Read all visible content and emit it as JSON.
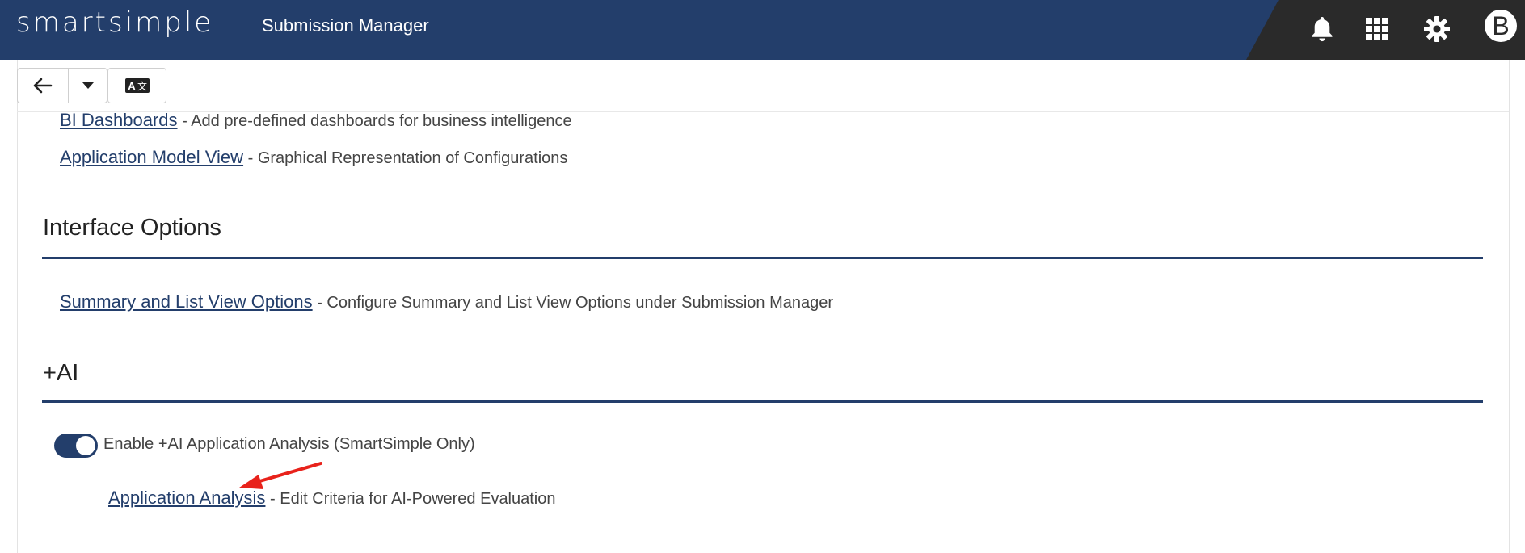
{
  "header": {
    "logo": "smartsimple",
    "app_title": "Submission Manager",
    "avatar_initial": "B",
    "icons": [
      "bell-icon",
      "apps-grid-icon",
      "gear-icon"
    ],
    "bg_color": "#233e6b"
  },
  "toolbar": {
    "buttons": [
      "back-arrow-icon",
      "dropdown-caret-icon",
      "translate-icon"
    ]
  },
  "links_top": [
    {
      "link": "BI Dashboards",
      "desc": " - Add pre-defined dashboards for business intelligence"
    },
    {
      "link": "Application Model View",
      "desc": " - Graphical Representation of Configurations"
    }
  ],
  "interface_options": {
    "title": "Interface Options",
    "link": "Summary and List View Options",
    "desc": " - Configure Summary and List View Options under Submission Manager"
  },
  "ai_section": {
    "title": "+AI",
    "toggle_label": "Enable +AI Application Analysis (SmartSimple Only)",
    "toggle_on": true,
    "link": "Application Analysis",
    "desc": " - Edit Criteria for AI-Powered Evaluation"
  },
  "colors": {
    "accent": "#233e6b",
    "annotation_arrow": "#e8221b"
  }
}
